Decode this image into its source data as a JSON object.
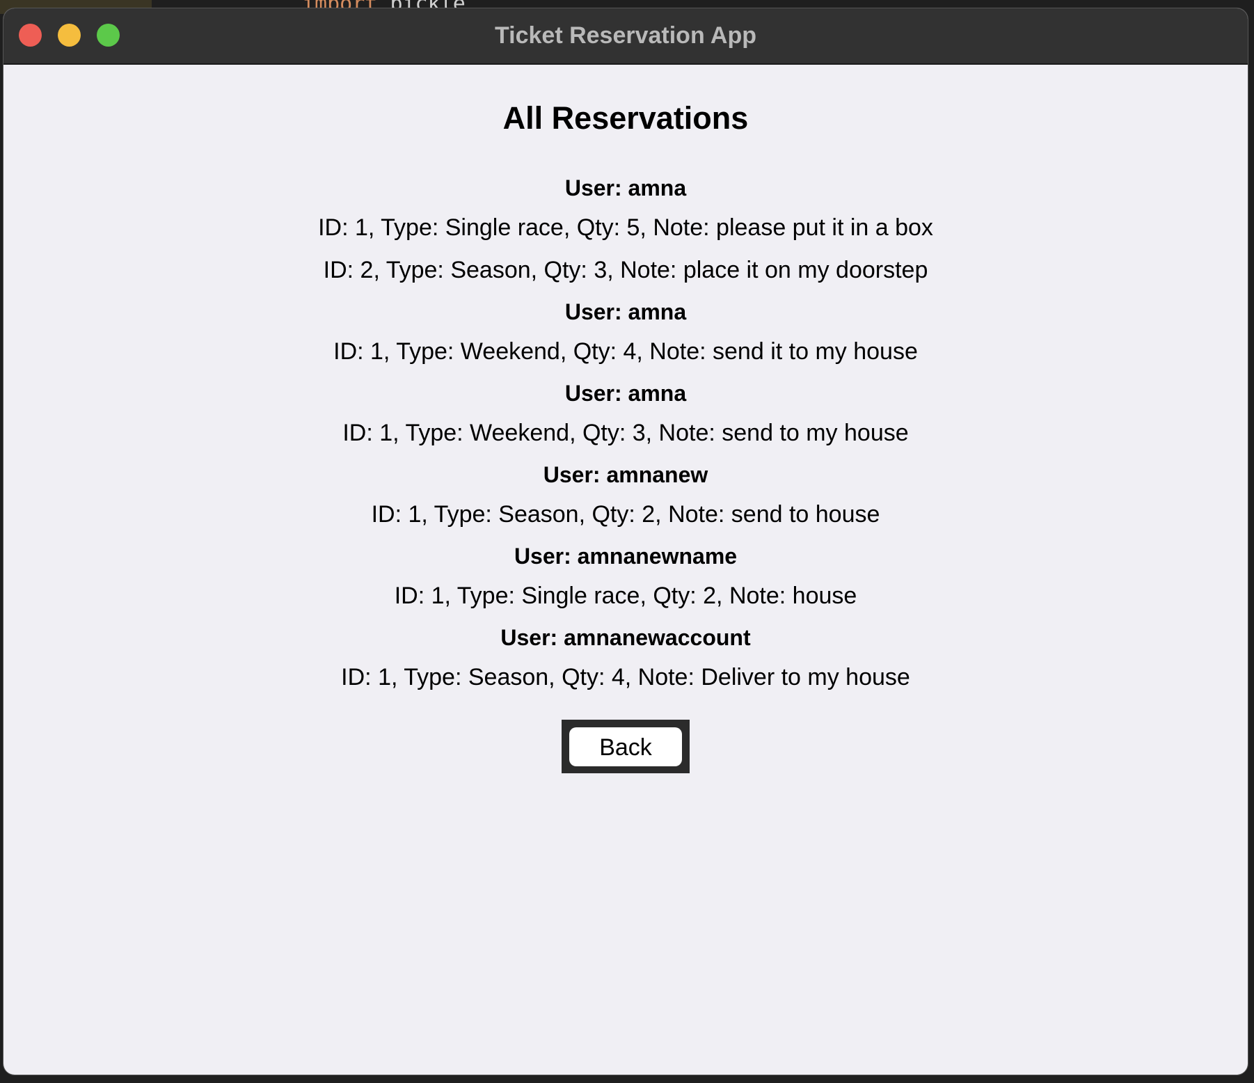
{
  "window": {
    "title": "Ticket Reservation App"
  },
  "page": {
    "title": "All Reservations"
  },
  "background_code": {
    "keyword": "import",
    "text": "pickle"
  },
  "groups": [
    {
      "user": "User: amna",
      "items": [
        "ID: 1, Type: Single race, Qty: 5, Note: please put it in a box",
        "ID: 2, Type: Season, Qty: 3, Note: place it on my doorstep"
      ]
    },
    {
      "user": "User: amna",
      "items": [
        "ID: 1, Type: Weekend, Qty: 4, Note: send it to my house"
      ]
    },
    {
      "user": "User: amna",
      "items": [
        "ID: 1, Type: Weekend, Qty: 3, Note: send to my house"
      ]
    },
    {
      "user": "User: amnanew",
      "items": [
        "ID: 1, Type: Season, Qty: 2, Note: send to house"
      ]
    },
    {
      "user": "User: amnanewname",
      "items": [
        "ID: 1, Type: Single race, Qty: 2, Note: house"
      ]
    },
    {
      "user": "User: amnanewaccount",
      "items": [
        "ID: 1, Type: Season, Qty: 4, Note: Deliver to my house"
      ]
    }
  ],
  "actions": {
    "back_label": "Back"
  },
  "colors": {
    "close": "#ee5e55",
    "minimize": "#f5bd3e",
    "maximize": "#5cc94a",
    "window_bg": "#f0eff4",
    "titlebar_bg": "#323232"
  }
}
